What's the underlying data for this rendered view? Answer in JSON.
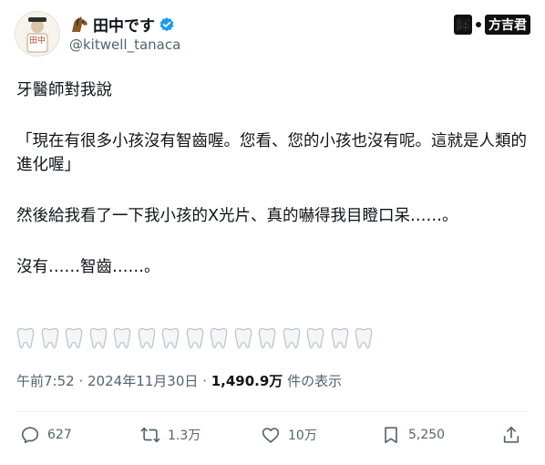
{
  "author": {
    "name": "田中です",
    "handle": "@kitwell_tanaca",
    "avatar_text": "田中"
  },
  "translator_credit": {
    "tag": "譯",
    "translator": "方吉君"
  },
  "tweet": {
    "paragraphs": [
      "牙醫師對我說",
      "「現在有很多小孩沒有智齒喔。您看、您的小孩也沒有呢。這就是人類的進化喔」",
      "然後給我看了一下我小孩的X光片、真的嚇得我目瞪口呆……。",
      "沒有……智齒……。"
    ],
    "teeth_emoji_count": 15
  },
  "meta": {
    "time": "午前7:52",
    "date": "2024年11月30日",
    "views": "1,490.9万",
    "views_suffix": "件の表示"
  },
  "actions": {
    "reply": "627",
    "retweet": "1.3万",
    "like": "10万",
    "bookmark": "5,250"
  },
  "colors": {
    "verified": "#1d9bf0",
    "secondary_text": "#536471",
    "primary_text": "#0f1419"
  }
}
